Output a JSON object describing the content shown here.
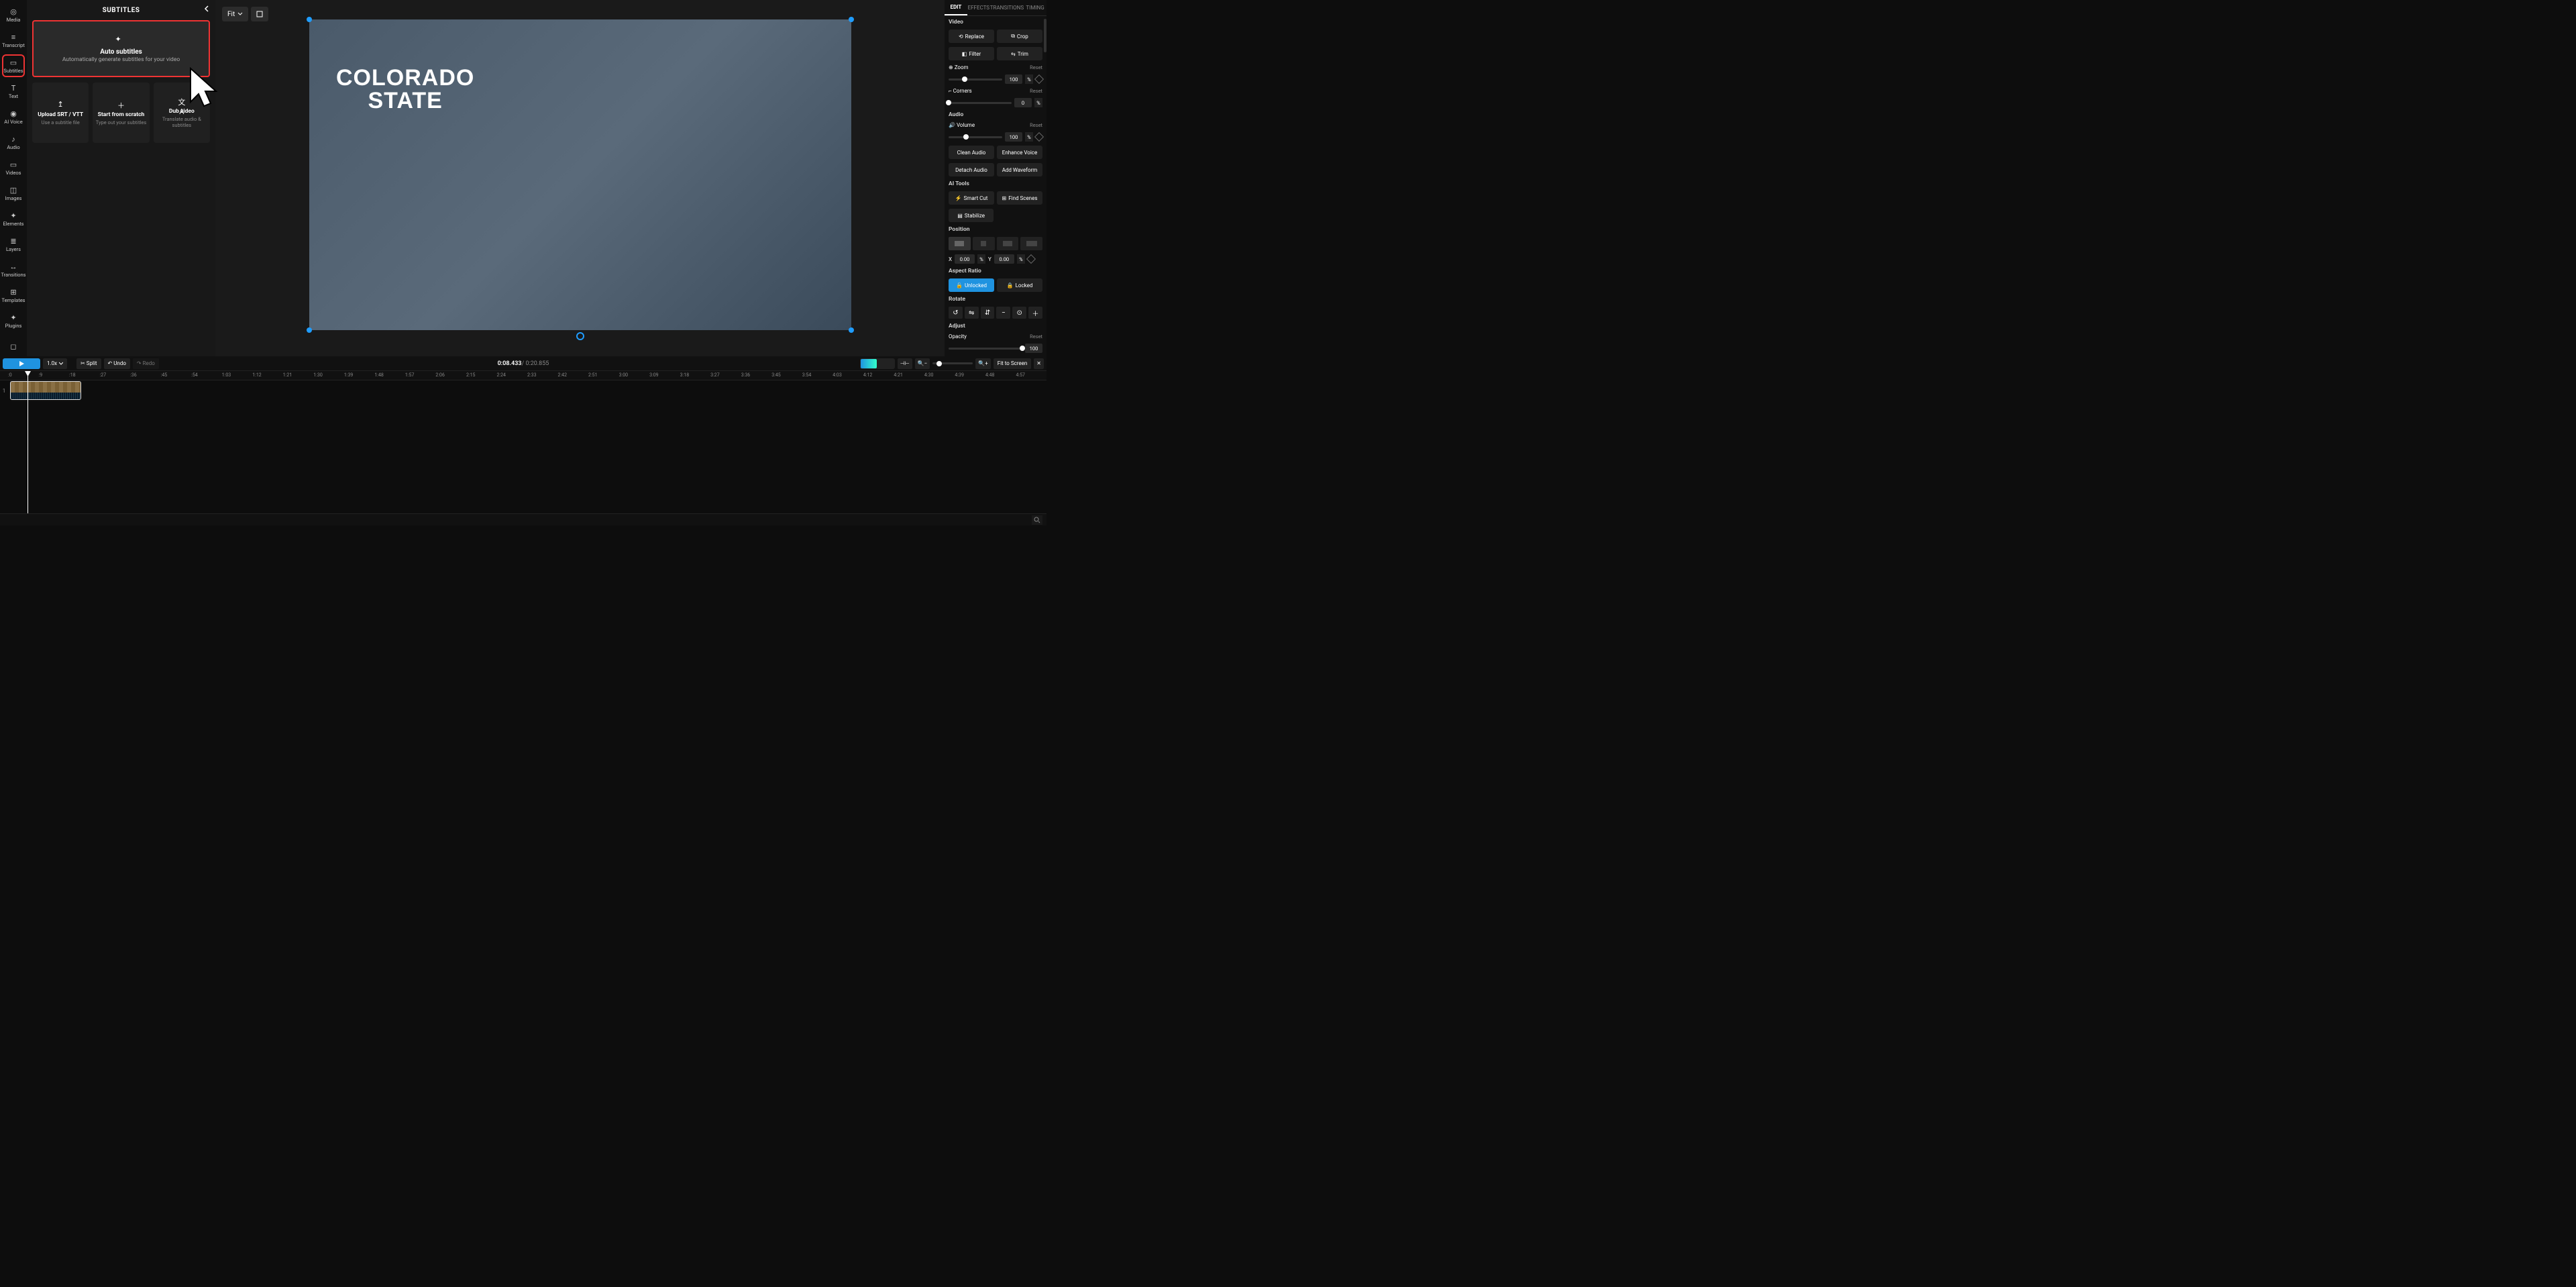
{
  "rail": [
    {
      "id": "media",
      "label": "Media"
    },
    {
      "id": "transcript",
      "label": "Transcript"
    },
    {
      "id": "subtitles",
      "label": "Subtitles",
      "active": true
    },
    {
      "id": "text",
      "label": "Text"
    },
    {
      "id": "aivoice",
      "label": "AI Voice"
    },
    {
      "id": "audio",
      "label": "Audio"
    },
    {
      "id": "videos",
      "label": "Videos"
    },
    {
      "id": "images",
      "label": "Images"
    },
    {
      "id": "elements",
      "label": "Elements"
    },
    {
      "id": "layers",
      "label": "Layers"
    },
    {
      "id": "transitions",
      "label": "Transitions"
    },
    {
      "id": "templates",
      "label": "Templates"
    },
    {
      "id": "plugins",
      "label": "Plugins"
    }
  ],
  "panel": {
    "title": "SUBTITLES",
    "auto": {
      "title": "Auto subtitles",
      "desc": "Automatically generate subtitles for your video"
    },
    "cards": [
      {
        "title": "Upload SRT / VTT",
        "desc": "Use a subtitle file"
      },
      {
        "title": "Start from scratch",
        "desc": "Type out your subtitles"
      },
      {
        "title": "Dub video",
        "desc": "Translate audio & subtitles"
      }
    ]
  },
  "fit_label": "Fit",
  "preview_text": {
    "line1": "COLORADO",
    "line2": "STATE"
  },
  "inspector": {
    "tabs": [
      "EDIT",
      "EFFECTS",
      "TRANSITIONS",
      "TIMING"
    ],
    "video_h": "Video",
    "replace": "Replace",
    "crop": "Crop",
    "filter": "Filter",
    "trim": "Trim",
    "zoom": "Zoom",
    "zoom_val": "100",
    "corners": "Corners",
    "corners_val": "0",
    "reset": "Reset",
    "pct": "%",
    "audio_h": "Audio",
    "volume": "Volume",
    "volume_val": "100",
    "clean": "Clean Audio",
    "enhance": "Enhance Voice",
    "detach": "Detach Audio",
    "addwave": "Add Waveform",
    "ai_h": "AI Tools",
    "smart": "Smart Cut",
    "find": "Find Scenes",
    "stab": "Stabilize",
    "pos_h": "Position",
    "x": "X",
    "y": "Y",
    "xv": "0.00",
    "yv": "0.00",
    "ar_h": "Aspect Ratio",
    "unlocked": "Unlocked",
    "locked": "Locked",
    "rotate_h": "Rotate",
    "adjust_h": "Adjust",
    "opacity": "Opacity",
    "op_val": "100"
  },
  "timeline": {
    "speed": "1.0x",
    "split": "Split",
    "undo": "Undo",
    "redo": "Redo",
    "current": "0:08.433",
    "total": "0:20.855",
    "sep": " / ",
    "fit_screen": "Fit to Screen",
    "ruler": [
      ":0",
      ":9",
      ":18",
      ":27",
      ":36",
      ":45",
      ":54",
      "1:03",
      "1:12",
      "1:21",
      "1:30",
      "1:39",
      "1:48",
      "1:57",
      "2:06",
      "2:15",
      "2:24",
      "2:33",
      "2:42",
      "2:51",
      "3:00",
      "3:09",
      "3:18",
      "3:27",
      "3:36",
      "3:45",
      "3:54",
      "4:03",
      "4:12",
      "4:21",
      "4:30",
      "4:39",
      "4:48",
      "4:57"
    ],
    "track_num": "1"
  }
}
